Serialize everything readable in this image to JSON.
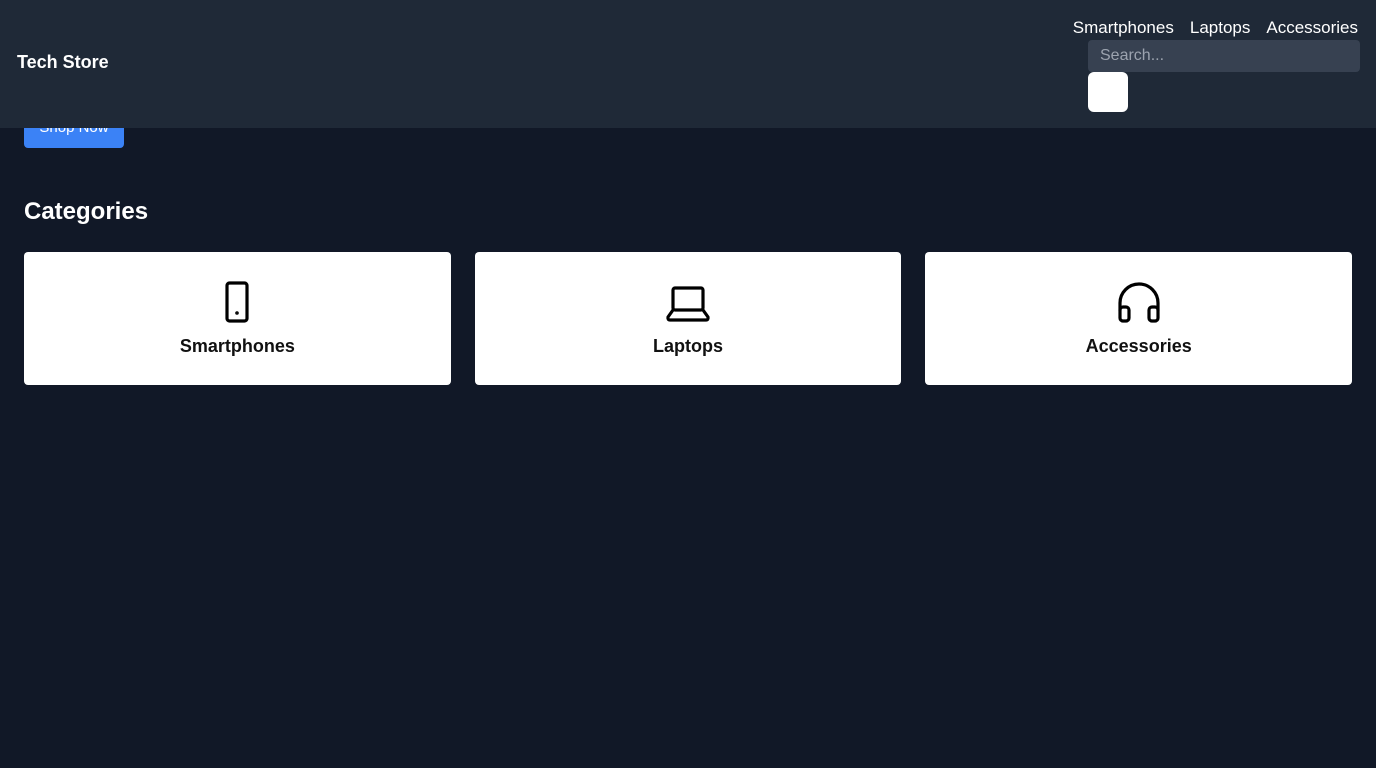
{
  "header": {
    "brand": "Tech Store",
    "nav": [
      {
        "label": "Smartphones"
      },
      {
        "label": "Laptops"
      },
      {
        "label": "Accessories"
      }
    ],
    "search": {
      "placeholder": "Search...",
      "value": ""
    }
  },
  "hero": {
    "cta_label": "Shop Now"
  },
  "categories": {
    "title": "Categories",
    "items": [
      {
        "label": "Smartphones",
        "icon": "smartphone-icon"
      },
      {
        "label": "Laptops",
        "icon": "laptop-icon"
      },
      {
        "label": "Accessories",
        "icon": "headphones-icon"
      }
    ]
  },
  "colors": {
    "background": "#111827",
    "header": "#1f2937",
    "search_bg": "#374151",
    "accent": "#3b82f6",
    "card": "#ffffff"
  }
}
